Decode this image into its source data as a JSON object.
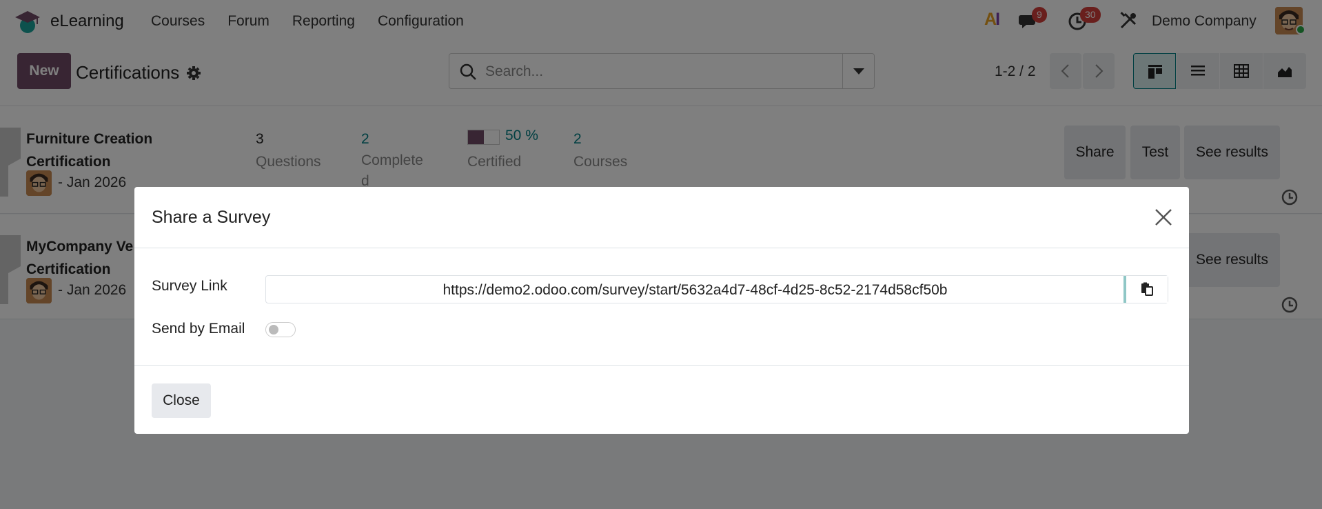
{
  "navbar": {
    "app_name": "eLearning",
    "menu": [
      "Courses",
      "Forum",
      "Reporting",
      "Configuration"
    ],
    "ai_label": "AI",
    "messages_count": "9",
    "activities_count": "30",
    "company": "Demo Company"
  },
  "control": {
    "new_label": "New",
    "title": "Certifications",
    "search_placeholder": "Search...",
    "pager": "1-2 / 2"
  },
  "records": [
    {
      "title": "Furniture Creation Certification",
      "date": "- Jan 2026",
      "questions": "3",
      "questions_label": "Questions",
      "completed": "2",
      "completed_label": "Complete\nd",
      "certified_pct": "50 %",
      "certified_value": 0.5,
      "certified_label": "Certified",
      "courses": "2",
      "courses_label": "Courses",
      "share_label": "Share",
      "test_label": "Test",
      "results_label": "See results"
    },
    {
      "title": "MyCompany Ve\nCertification",
      "date": "- Jan 2026",
      "results_label": "See results"
    }
  ],
  "modal": {
    "title": "Share a Survey",
    "link_label": "Survey Link",
    "link": "https://demo2.odoo.com/survey/start/5632a4d7-48cf-4d25-8c52-2174d58cf50b",
    "email_label": "Send by Email",
    "send_by_email": false,
    "close_label": "Close"
  },
  "colors": {
    "brand_purple": "#714b67",
    "teal": "#017e84",
    "badge_red": "#d23f3a"
  }
}
